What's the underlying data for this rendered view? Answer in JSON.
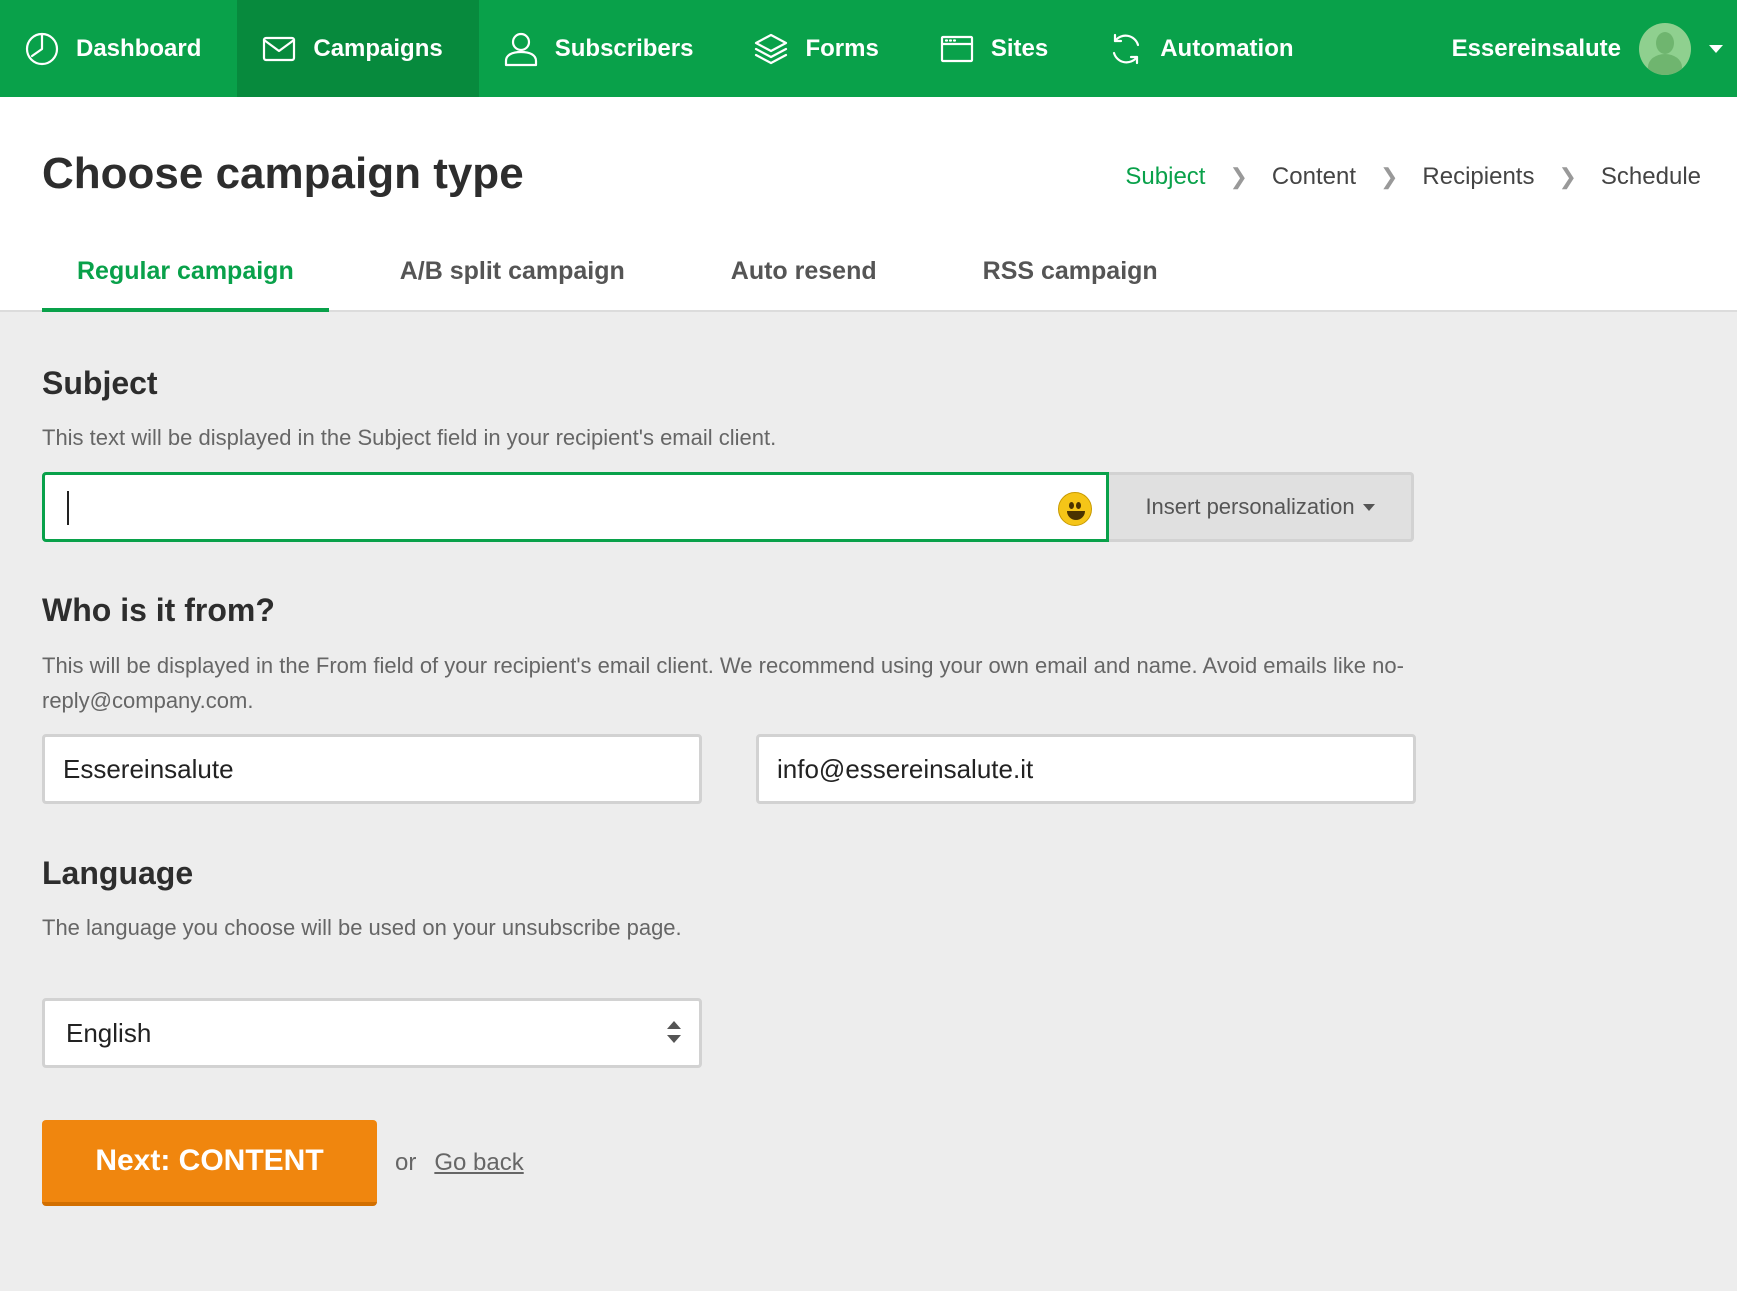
{
  "nav": {
    "items": [
      {
        "label": "Dashboard",
        "icon": "clock-icon"
      },
      {
        "label": "Campaigns",
        "icon": "envelope-icon"
      },
      {
        "label": "Subscribers",
        "icon": "user-icon"
      },
      {
        "label": "Forms",
        "icon": "layers-icon"
      },
      {
        "label": "Sites",
        "icon": "browser-icon"
      },
      {
        "label": "Automation",
        "icon": "refresh-icon"
      }
    ],
    "active": "Campaigns",
    "user": "Essereinsalute",
    "accent": "#09a14a"
  },
  "header": {
    "title": "Choose campaign type",
    "breadcrumb": [
      "Subject",
      "Content",
      "Recipients",
      "Schedule"
    ],
    "breadcrumb_active": "Subject"
  },
  "tabs": [
    "Regular campaign",
    "A/B split campaign",
    "Auto resend",
    "RSS campaign"
  ],
  "tabs_active": "Regular campaign",
  "subject": {
    "title": "Subject",
    "help": "This text will be displayed in the Subject field in your recipient's email client.",
    "value": "",
    "insert_label": "Insert personalization"
  },
  "from": {
    "title": "Who is it from?",
    "help": "This will be displayed in the From field of your recipient's email client. We recommend using your own email and name. Avoid emails like no-reply@company.com.",
    "name": "Essereinsalute",
    "email": "info@essereinsalute.it"
  },
  "language": {
    "title": "Language",
    "help": "The language you choose will be used on your unsubscribe page.",
    "selected": "English"
  },
  "actions": {
    "next_label": "Next: CONTENT",
    "or_label": "or",
    "back_label": "Go back",
    "next_color": "#f0860e"
  }
}
